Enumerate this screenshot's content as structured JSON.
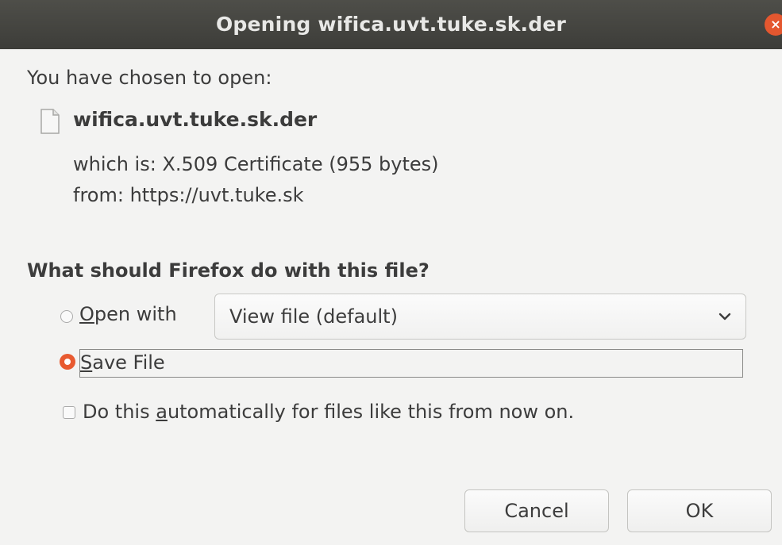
{
  "window": {
    "title": "Opening wifica.uvt.tuke.sk.der",
    "close_glyph": "×"
  },
  "info": {
    "chosen_text": "You have chosen to open:",
    "file_name": "wifica.uvt.tuke.sk.der",
    "which_is": "which is: X.509 Certificate (955 bytes)",
    "from": "from: https://uvt.tuke.sk",
    "icon": "document-icon"
  },
  "question": "What should Firefox do with this file?",
  "options": {
    "open_with": {
      "label_mnemonic": "O",
      "label_rest": "pen with",
      "selected": false,
      "app_value": "View file (default)"
    },
    "save_file": {
      "label_mnemonic": "S",
      "label_rest": "ave File",
      "selected": true
    },
    "auto": {
      "label_before": "Do this ",
      "label_mnemonic": "a",
      "label_after": "utomatically for files like this from now on.",
      "checked": false
    }
  },
  "buttons": {
    "cancel": "Cancel",
    "ok": "OK"
  },
  "colors": {
    "titlebar": "#45453f",
    "accent": "#e85a30",
    "background": "#f3f3f2"
  }
}
